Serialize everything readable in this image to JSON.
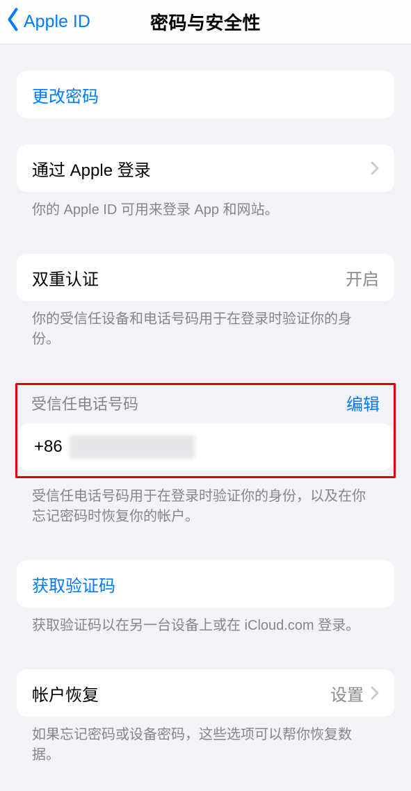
{
  "nav": {
    "back_label": "Apple ID",
    "title": "密码与安全性"
  },
  "change_password": {
    "label": "更改密码"
  },
  "sign_in_with_apple": {
    "label": "通过 Apple 登录",
    "footer": "你的 Apple ID 可用来登录 App 和网站。"
  },
  "two_factor": {
    "label": "双重认证",
    "value": "开启",
    "footer": "你的受信任设备和电话号码用于在登录时验证你的身份。"
  },
  "trusted_phone": {
    "header": "受信任电话号码",
    "edit": "编辑",
    "prefix": "+86",
    "footer": "受信任电话号码用于在登录时验证你的身份，以及在你忘记密码时恢复你的帐户。"
  },
  "get_code": {
    "label": "获取验证码",
    "footer": "获取验证码以在另一台设备上或在 iCloud.com 登录。"
  },
  "account_recovery": {
    "label": "帐户恢复",
    "value": "设置",
    "footer": "如果忘记密码或设备密码，这些选项可以帮你恢复数据。"
  }
}
